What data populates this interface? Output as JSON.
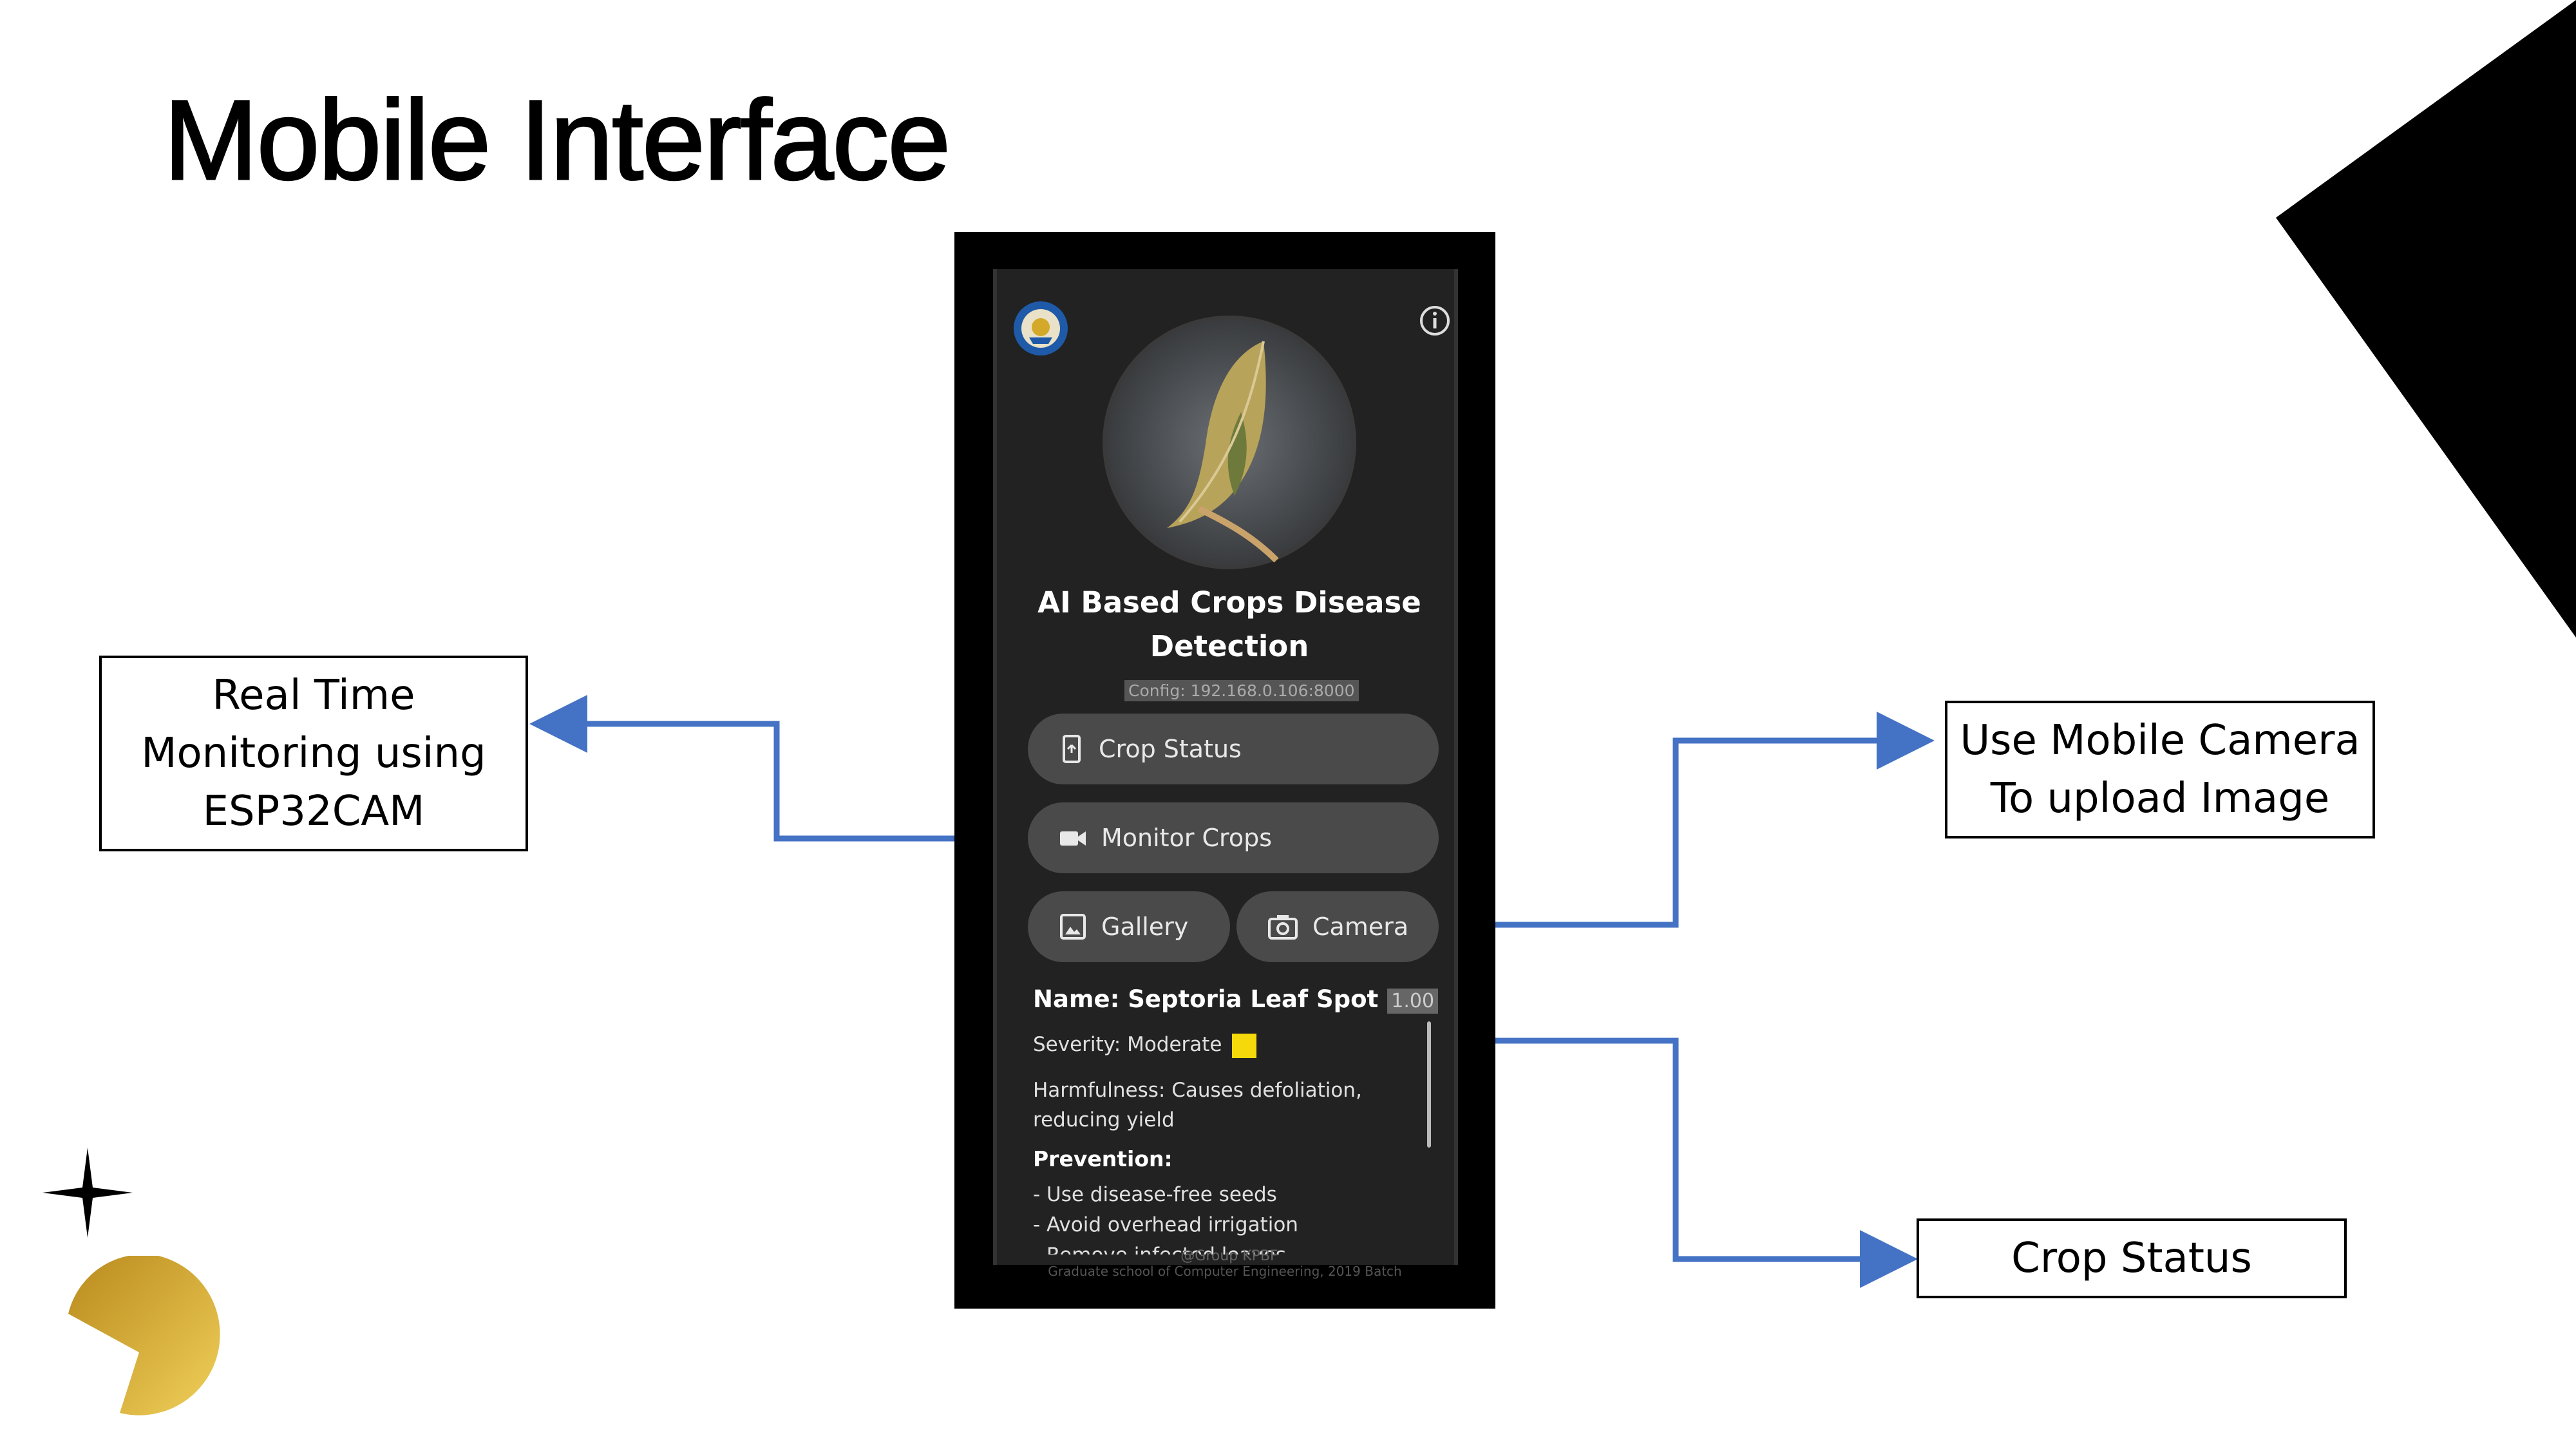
{
  "slide": {
    "title": "Mobile Interface"
  },
  "callouts": {
    "realtime": [
      "Real Time",
      "Monitoring using",
      "ESP32CAM"
    ],
    "camera": [
      "Use Mobile Camera",
      "To upload Image"
    ],
    "crop_status": [
      "Crop Status"
    ]
  },
  "app": {
    "logo_icon": "university-seal-icon",
    "info_icon": "info-icon",
    "title_line1": "AI Based Crops Disease",
    "title_line2": "Detection",
    "config": "Config: 192.168.0.106:8000",
    "buttons": {
      "crop_status": "Crop Status",
      "monitor_crops": "Monitor Crops",
      "gallery": "Gallery",
      "camera": "Camera"
    },
    "result": {
      "name": "Name: Septoria Leaf Spot",
      "confidence": "1.00",
      "severity": "Severity: Moderate",
      "severity_color": "#f5d90a",
      "harmfulness_line1": "Harmfulness: Causes defoliation,",
      "harmfulness_line2": "reducing yield",
      "prevention_title": "Prevention:",
      "prevention_items": [
        "- Use disease-free seeds",
        "- Avoid overhead irrigation",
        "- Remove infected leaves"
      ]
    },
    "footer_group": "@Group KPBF",
    "footer_school": "Graduate school of Computer Engineering, 2019 Batch"
  },
  "colors": {
    "arrow": "#4472c4",
    "accent_gold": "#d4a92a"
  }
}
